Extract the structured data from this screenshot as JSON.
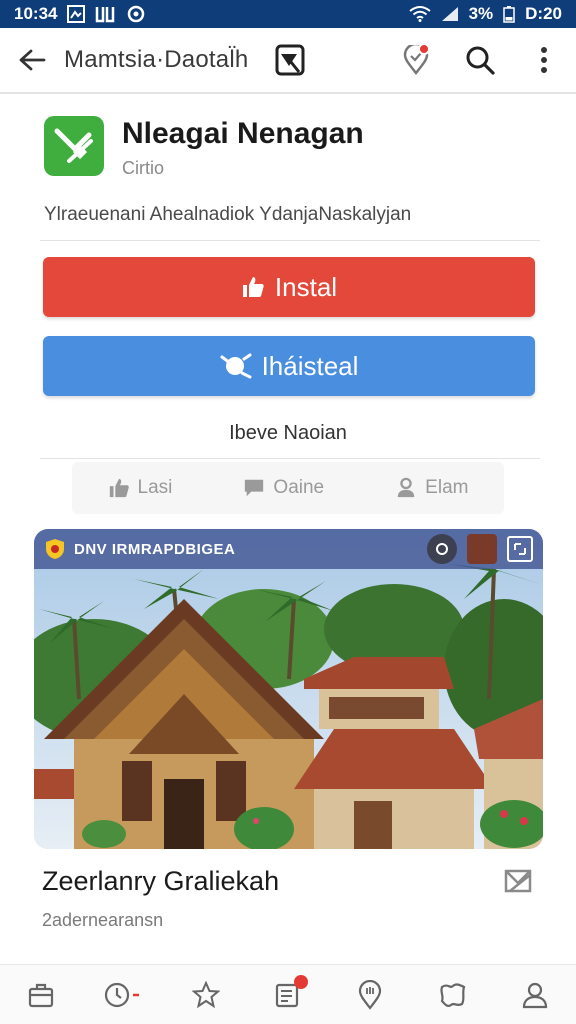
{
  "status_bar": {
    "time_left": "10:34",
    "battery": "3%",
    "time_right": "D:20"
  },
  "app_bar": {
    "title": "Mamtsia·Daotal̈h"
  },
  "header": {
    "name": "Nleagai Nenagan",
    "subtitle": "Cirtio",
    "description": "Ylraeuenani Ahealnadiok YdanjaNaskalyjan"
  },
  "buttons": {
    "primary_label": "Instal",
    "secondary_label": "Iháisteal"
  },
  "link_text": "Ibeve Naoian",
  "actions": [
    {
      "label": "Lasi",
      "icon": "thumbs-up-icon"
    },
    {
      "label": "Oaine",
      "icon": "comment-icon"
    },
    {
      "label": "Elam",
      "icon": "person-icon"
    }
  ],
  "card": {
    "header_text": "DNV IRMRAPDBIGEA"
  },
  "post": {
    "title": "Zeerlanry Graliekah",
    "subtitle": "2adernearansn"
  },
  "colors": {
    "status_bar": "#0f3d7a",
    "install_red": "#e4483a",
    "install_blue": "#4a8ee0",
    "app_icon_green": "#3fae3f"
  }
}
